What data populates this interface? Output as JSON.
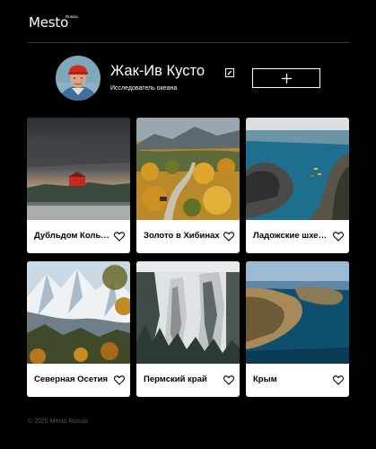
{
  "header": {
    "logo": "Mesto",
    "logo_sub": "Russia"
  },
  "profile": {
    "name": "Жак-Ив Кусто",
    "about": "Исследователь океана",
    "avatar_icon": "avatar-photo"
  },
  "cards": [
    {
      "title": "Дубльдом Кольский"
    },
    {
      "title": "Золото в Хибинах"
    },
    {
      "title": "Ладожские шхеры"
    },
    {
      "title": "Северная Осетия"
    },
    {
      "title": "Пермский край"
    },
    {
      "title": "Крым"
    }
  ],
  "footer": {
    "copyright": "© 2020 Mesto Russia"
  },
  "colors": {
    "background": "#000000",
    "card": "#ffffff",
    "footer_text": "#545454",
    "divider": "#545454"
  }
}
